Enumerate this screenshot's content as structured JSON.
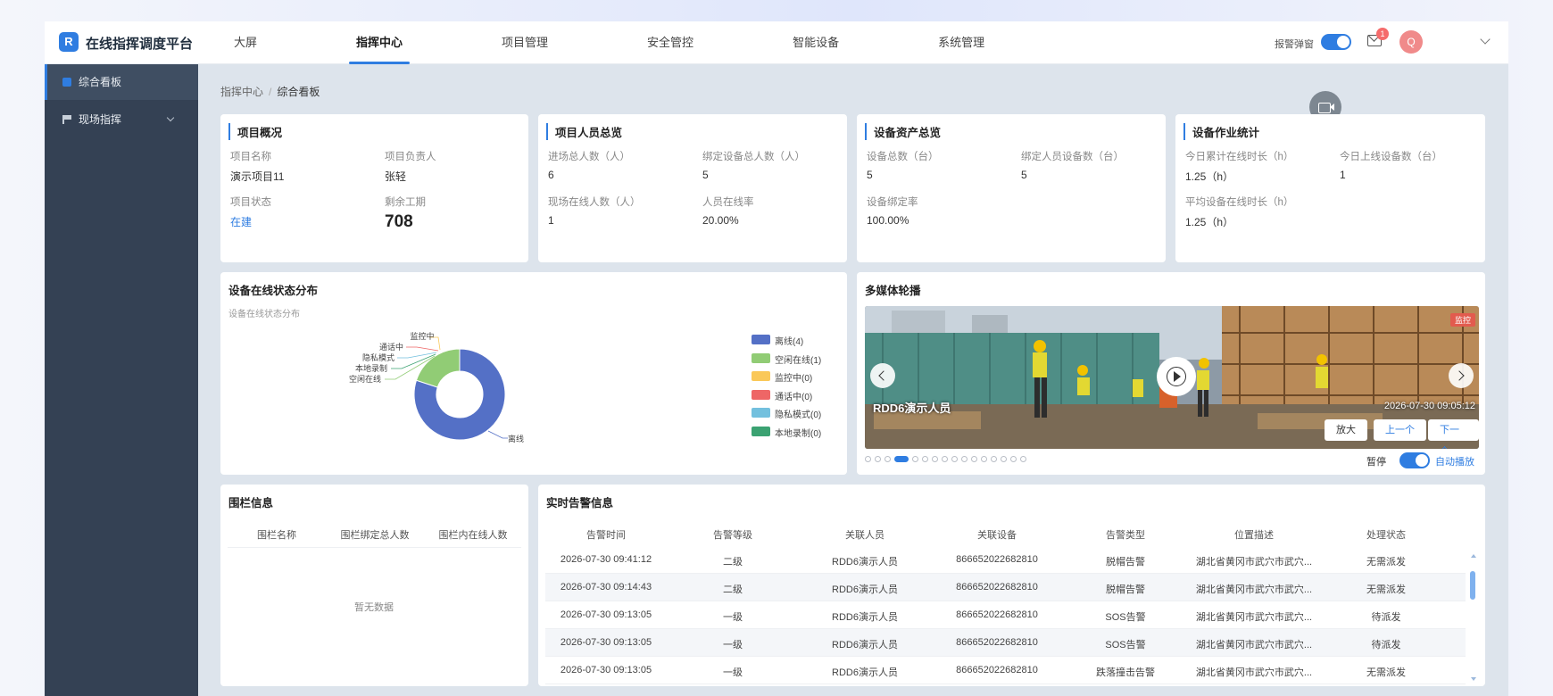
{
  "header": {
    "logo_letter": "R",
    "brand": "在线指挥调度平台",
    "nav": [
      {
        "label": "大屏"
      },
      {
        "label": "指挥中心"
      },
      {
        "label": "项目管理"
      },
      {
        "label": "安全管控"
      },
      {
        "label": "智能设备"
      },
      {
        "label": "系统管理"
      }
    ],
    "alarm_popup_label": "报警弹窗",
    "alarm_popup_on": true,
    "mail_badge": "1",
    "avatar_letter": "Q"
  },
  "sidebar": {
    "items": [
      {
        "label": "综合看板",
        "icon": "dashboard-icon"
      },
      {
        "label": "现场指挥",
        "icon": "flag-icon"
      }
    ]
  },
  "breadcrumb": {
    "root": "指挥中心",
    "separator": "/",
    "current": "综合看板"
  },
  "project": {
    "title": "项目概况",
    "name_label": "项目名称",
    "name": "演示项目11",
    "owner_label": "项目负责人",
    "owner": "张轻",
    "status_label": "项目状态",
    "status": "在建",
    "remaining_label": "剩余工期",
    "remaining": "708"
  },
  "personnel": {
    "title": "项目人员总览",
    "entered_label": "进场总人数（人）",
    "entered": "6",
    "bound_label": "绑定设备总人数（人）",
    "bound": "5",
    "online_label": "现场在线人数（人）",
    "online": "1",
    "rate_label": "人员在线率",
    "rate": "20.00%"
  },
  "assets": {
    "title": "设备资产总览",
    "total_label": "设备总数（台）",
    "total": "5",
    "bound_label": "绑定人员设备数（台）",
    "bound": "5",
    "bind_rate_label": "设备绑定率",
    "bind_rate": "100.00%"
  },
  "operation": {
    "title": "设备作业统计",
    "today_hours_label": "今日累计在线时长（h）",
    "today_hours": "1.25（h）",
    "today_devices_label": "今日上线设备数（台）",
    "today_devices": "1",
    "avg_hours_label": "平均设备在线时长（h）",
    "avg_hours": "1.25（h）"
  },
  "status_chart": {
    "title": "设备在线状态分布",
    "subtitle": "设备在线状态分布"
  },
  "chart_data": {
    "type": "pie",
    "title": "设备在线状态分布",
    "donut": true,
    "categories": [
      "离线",
      "空闲在线",
      "监控中",
      "通话中",
      "隐私模式",
      "本地录制"
    ],
    "values": [
      4,
      1,
      0,
      0,
      0,
      0
    ],
    "legend": [
      "离线(4)",
      "空闲在线(1)",
      "监控中(0)",
      "通话中(0)",
      "隐私模式(0)",
      "本地录制(0)"
    ],
    "colors": [
      "#5470c6",
      "#91cc75",
      "#fac858",
      "#ee6666",
      "#73c0de",
      "#3ba272"
    ],
    "legend_position": "right"
  },
  "media": {
    "title": "多媒体轮播",
    "live_tag": "监控",
    "caption": "RDD6演示人员",
    "timestamp": "2026-07-30 09:05:12",
    "btn_zoom": "放大",
    "btn_prev": "上一个",
    "btn_next": "下一个",
    "pause_label": "暂停",
    "autoplay_label": "自动播放",
    "autoplay_on": true,
    "dot_count": 16,
    "active_dot": 3
  },
  "fence": {
    "title": "围栏信息",
    "headers": [
      "围栏名称",
      "围栏绑定总人数",
      "围栏内在线人数"
    ],
    "empty": "暂无数据"
  },
  "alerts": {
    "title": "实时告警信息",
    "headers": [
      "告警时间",
      "告警等级",
      "关联人员",
      "关联设备",
      "告警类型",
      "位置描述",
      "处理状态"
    ],
    "rows": [
      [
        "2026-07-30 09:41:12",
        "二级",
        "RDD6演示人员",
        "866652022682810",
        "脱帽告警",
        "湖北省黄冈市武穴市武穴...",
        "无需派发"
      ],
      [
        "2026-07-30 09:14:43",
        "二级",
        "RDD6演示人员",
        "866652022682810",
        "脱帽告警",
        "湖北省黄冈市武穴市武穴...",
        "无需派发"
      ],
      [
        "2026-07-30 09:13:05",
        "一级",
        "RDD6演示人员",
        "866652022682810",
        "SOS告警",
        "湖北省黄冈市武穴市武穴...",
        "待派发"
      ],
      [
        "2026-07-30 09:13:05",
        "一级",
        "RDD6演示人员",
        "866652022682810",
        "SOS告警",
        "湖北省黄冈市武穴市武穴...",
        "待派发"
      ],
      [
        "2026-07-30 09:13:05",
        "一级",
        "RDD6演示人员",
        "866652022682810",
        "跌落撞击告警",
        "湖北省黄冈市武穴市武穴...",
        "无需派发"
      ]
    ]
  },
  "colors": {
    "accent": "#2f7de1",
    "sidebar": "#344154",
    "badge": "#f56c6c",
    "avatar": "#f08a8a"
  }
}
